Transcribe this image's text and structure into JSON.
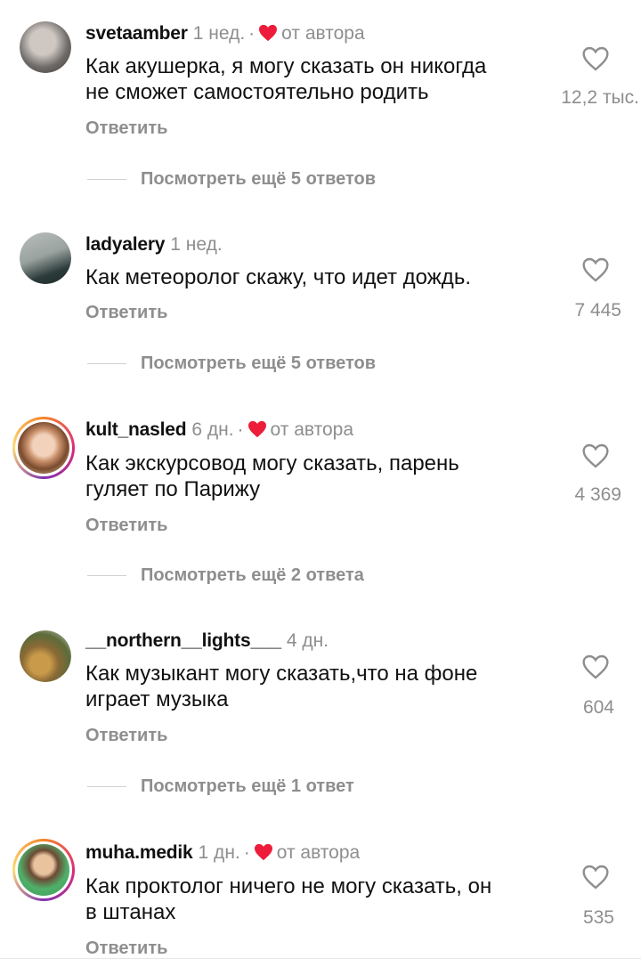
{
  "reply_label": "Ответить",
  "comments": [
    {
      "username": "svetaamber",
      "time": "1 нед.",
      "by_author": true,
      "by_author_label": "от автора",
      "text_lines": [
        "Как акушерка, я могу сказать он никогда",
        "не сможет самостоятельно родить"
      ],
      "likes": "12,2 тыс.",
      "more_replies": "Посмотреть ещё 5 ответов",
      "avatar_colors": [
        "#6e6b69",
        "#cfc8c2"
      ]
    },
    {
      "username": "ladyalery",
      "time": "1 нед.",
      "by_author": false,
      "text_lines": [
        "Как метеоролог скажу, что идет дождь."
      ],
      "likes": "7 445",
      "more_replies": "Посмотреть ещё 5 ответов",
      "avatar_colors": [
        "#9aa3a0",
        "#2b3b3a"
      ]
    },
    {
      "username": "kult_nasled",
      "time": "6 дн.",
      "by_author": true,
      "by_author_label": "от автора",
      "text_lines": [
        "Как экскурсовод могу сказать, парень",
        "гуляет по Парижу"
      ],
      "likes": "4 369",
      "more_replies": "Посмотреть ещё 2 ответа",
      "avatar_colors": [
        "#e7c3a8",
        "#7a4b2f"
      ]
    },
    {
      "username": "__northern__lights___",
      "time": "4 дн.",
      "by_author": false,
      "text_lines": [
        "Как музыкант могу сказать,что на фоне",
        "играет музыка"
      ],
      "likes": "604",
      "more_replies": "Посмотреть ещё 1 ответ",
      "avatar_colors": [
        "#5c6b3a",
        "#c99a4a"
      ]
    },
    {
      "username": "muha.medik",
      "time": "1 дн.",
      "by_author": true,
      "by_author_label": "от автора",
      "text_lines": [
        "Как проктолог ничего не могу сказать, он",
        "в штанах"
      ],
      "likes": "535",
      "avatar_colors": [
        "#4fb06a",
        "#e8c39e"
      ]
    }
  ],
  "colors": {
    "heart_red": "#ed1c3a",
    "muted": "#8e8e8e"
  }
}
